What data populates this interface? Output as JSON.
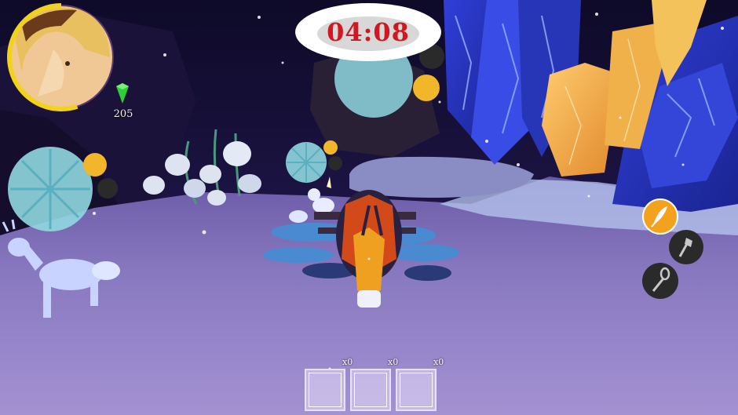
{
  "timer": {
    "value": "04:08"
  },
  "player": {
    "gems": "205",
    "health_fraction": 0.55
  },
  "toolbar": [
    {
      "icon": "feather-icon",
      "active": true
    },
    {
      "icon": "axe-icon",
      "active": false
    },
    {
      "icon": "shovel-icon",
      "active": false
    }
  ],
  "inventory": [
    {
      "count": "x0"
    },
    {
      "count": "x0"
    },
    {
      "count": "x0"
    }
  ],
  "colors": {
    "timer_text": "#d01820",
    "gem": "#2ecf3a",
    "health_ring": "#f2d21c",
    "tool_active": "#f2a21c"
  }
}
